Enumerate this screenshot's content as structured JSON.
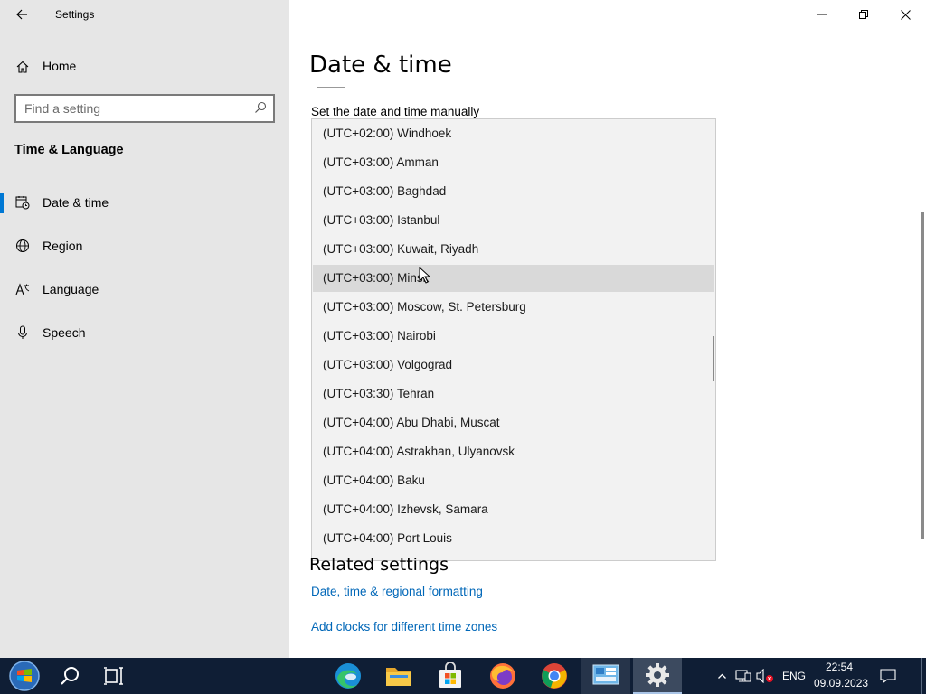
{
  "window": {
    "app_title": "Settings",
    "back_icon": "back-arrow-icon",
    "controls": [
      "minimize",
      "restore",
      "close"
    ]
  },
  "nav": {
    "home_label": "Home",
    "search_placeholder": "Find a setting",
    "section_title": "Time & Language",
    "items": [
      {
        "label": "Date & time",
        "icon": "calendar-clock-icon",
        "active": true
      },
      {
        "label": "Region",
        "icon": "globe-icon",
        "active": false
      },
      {
        "label": "Language",
        "icon": "language-icon",
        "active": false
      },
      {
        "label": "Speech",
        "icon": "microphone-icon",
        "active": false
      }
    ]
  },
  "main": {
    "page_title": "Date & time",
    "manual_label": "Set the date and time manually",
    "timezone_options": [
      "(UTC+02:00) Windhoek",
      "(UTC+03:00) Amman",
      "(UTC+03:00) Baghdad",
      "(UTC+03:00) Istanbul",
      "(UTC+03:00) Kuwait, Riyadh",
      "(UTC+03:00) Minsk",
      "(UTC+03:00) Moscow, St. Petersburg",
      "(UTC+03:00) Nairobi",
      "(UTC+03:00) Volgograd",
      "(UTC+03:30) Tehran",
      "(UTC+04:00) Abu Dhabi, Muscat",
      "(UTC+04:00) Astrakhan, Ulyanovsk",
      "(UTC+04:00) Baku",
      "(UTC+04:00) Izhevsk, Samara",
      "(UTC+04:00) Port Louis"
    ],
    "hovered_option": "(UTC+03:00) Minsk",
    "related_title": "Related settings",
    "links": [
      "Date, time & regional formatting",
      "Add clocks for different time zones"
    ]
  },
  "taskbar": {
    "apps": [
      "start-orb",
      "search",
      "task-view",
      "edge",
      "file-explorer",
      "microsoft-store",
      "firefox",
      "chrome",
      "control-panel",
      "settings"
    ],
    "language": "ENG",
    "time": "22:54",
    "date": "09.09.2023"
  },
  "colors": {
    "accent": "#0078d4",
    "link": "#0067b8",
    "nav_bg": "#e6e6e6",
    "taskbar_bg": "#0f1e35"
  }
}
